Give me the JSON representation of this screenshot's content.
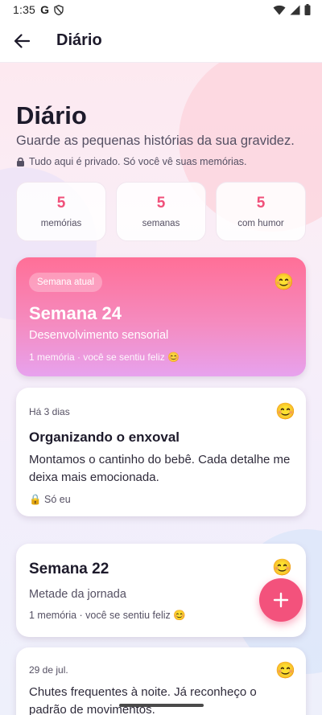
{
  "status_bar": {
    "time": "1:35",
    "g_label": "G"
  },
  "app_bar": {
    "title": "Diário",
    "back_icon": "arrow-left-icon"
  },
  "hero": {
    "title": "Diário",
    "subtitle": "Guarde as pequenas histórias da sua gravidez.",
    "privacy_note": "Tudo aqui é privado. Só você vê suas memórias.",
    "privacy_icon": "lock-icon"
  },
  "stats": [
    {
      "value": "5",
      "label": "memórias"
    },
    {
      "value": "5",
      "label": "semanas"
    },
    {
      "value": "5",
      "label": "com humor"
    }
  ],
  "current_week": {
    "badge": "Semana atual",
    "title": "Semana 24",
    "subtitle": "Desenvolvimento sensorial",
    "meta": "1 memória · você se sentiu feliz 😊",
    "emoji": "😊"
  },
  "entries": [
    {
      "date": "Há 3 dias",
      "title": "Organizando o enxoval",
      "body": "Montamos o cantinho do bebê. Cada detalhe me deixa mais emocionada.",
      "privacy": "🔒 Só eu",
      "emoji": "😊"
    }
  ],
  "week_card": {
    "title": "Semana 22",
    "subtitle": "Metade da jornada",
    "meta": "1 memória · você se sentiu feliz 😊",
    "emoji": "😊"
  },
  "entry2": {
    "date": "29 de jul.",
    "body": "Chutes frequentes à noite. Já reconheço o padrão de movimentos.",
    "emoji": "😊"
  },
  "fab": {
    "icon": "plus-icon"
  },
  "colors": {
    "accent": "#f3527c",
    "stat_number": "#f0507a",
    "gradient_start": "#ff6f97",
    "gradient_end": "#e7a2ee"
  }
}
